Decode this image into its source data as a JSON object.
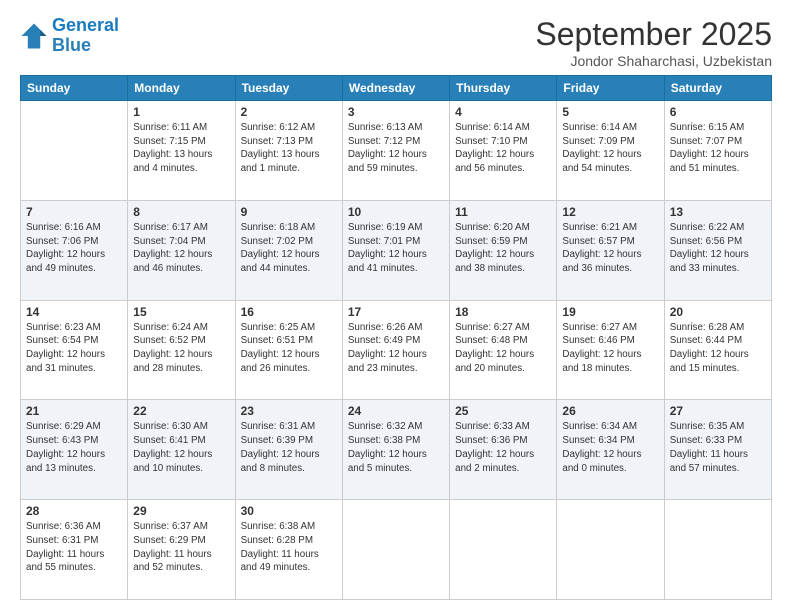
{
  "header": {
    "logo_line1": "General",
    "logo_line2": "Blue",
    "month": "September 2025",
    "location": "Jondor Shaharchasi, Uzbekistan"
  },
  "weekdays": [
    "Sunday",
    "Monday",
    "Tuesday",
    "Wednesday",
    "Thursday",
    "Friday",
    "Saturday"
  ],
  "weeks": [
    [
      {
        "day": "",
        "info": ""
      },
      {
        "day": "1",
        "info": "Sunrise: 6:11 AM\nSunset: 7:15 PM\nDaylight: 13 hours\nand 4 minutes."
      },
      {
        "day": "2",
        "info": "Sunrise: 6:12 AM\nSunset: 7:13 PM\nDaylight: 13 hours\nand 1 minute."
      },
      {
        "day": "3",
        "info": "Sunrise: 6:13 AM\nSunset: 7:12 PM\nDaylight: 12 hours\nand 59 minutes."
      },
      {
        "day": "4",
        "info": "Sunrise: 6:14 AM\nSunset: 7:10 PM\nDaylight: 12 hours\nand 56 minutes."
      },
      {
        "day": "5",
        "info": "Sunrise: 6:14 AM\nSunset: 7:09 PM\nDaylight: 12 hours\nand 54 minutes."
      },
      {
        "day": "6",
        "info": "Sunrise: 6:15 AM\nSunset: 7:07 PM\nDaylight: 12 hours\nand 51 minutes."
      }
    ],
    [
      {
        "day": "7",
        "info": "Sunrise: 6:16 AM\nSunset: 7:06 PM\nDaylight: 12 hours\nand 49 minutes."
      },
      {
        "day": "8",
        "info": "Sunrise: 6:17 AM\nSunset: 7:04 PM\nDaylight: 12 hours\nand 46 minutes."
      },
      {
        "day": "9",
        "info": "Sunrise: 6:18 AM\nSunset: 7:02 PM\nDaylight: 12 hours\nand 44 minutes."
      },
      {
        "day": "10",
        "info": "Sunrise: 6:19 AM\nSunset: 7:01 PM\nDaylight: 12 hours\nand 41 minutes."
      },
      {
        "day": "11",
        "info": "Sunrise: 6:20 AM\nSunset: 6:59 PM\nDaylight: 12 hours\nand 38 minutes."
      },
      {
        "day": "12",
        "info": "Sunrise: 6:21 AM\nSunset: 6:57 PM\nDaylight: 12 hours\nand 36 minutes."
      },
      {
        "day": "13",
        "info": "Sunrise: 6:22 AM\nSunset: 6:56 PM\nDaylight: 12 hours\nand 33 minutes."
      }
    ],
    [
      {
        "day": "14",
        "info": "Sunrise: 6:23 AM\nSunset: 6:54 PM\nDaylight: 12 hours\nand 31 minutes."
      },
      {
        "day": "15",
        "info": "Sunrise: 6:24 AM\nSunset: 6:52 PM\nDaylight: 12 hours\nand 28 minutes."
      },
      {
        "day": "16",
        "info": "Sunrise: 6:25 AM\nSunset: 6:51 PM\nDaylight: 12 hours\nand 26 minutes."
      },
      {
        "day": "17",
        "info": "Sunrise: 6:26 AM\nSunset: 6:49 PM\nDaylight: 12 hours\nand 23 minutes."
      },
      {
        "day": "18",
        "info": "Sunrise: 6:27 AM\nSunset: 6:48 PM\nDaylight: 12 hours\nand 20 minutes."
      },
      {
        "day": "19",
        "info": "Sunrise: 6:27 AM\nSunset: 6:46 PM\nDaylight: 12 hours\nand 18 minutes."
      },
      {
        "day": "20",
        "info": "Sunrise: 6:28 AM\nSunset: 6:44 PM\nDaylight: 12 hours\nand 15 minutes."
      }
    ],
    [
      {
        "day": "21",
        "info": "Sunrise: 6:29 AM\nSunset: 6:43 PM\nDaylight: 12 hours\nand 13 minutes."
      },
      {
        "day": "22",
        "info": "Sunrise: 6:30 AM\nSunset: 6:41 PM\nDaylight: 12 hours\nand 10 minutes."
      },
      {
        "day": "23",
        "info": "Sunrise: 6:31 AM\nSunset: 6:39 PM\nDaylight: 12 hours\nand 8 minutes."
      },
      {
        "day": "24",
        "info": "Sunrise: 6:32 AM\nSunset: 6:38 PM\nDaylight: 12 hours\nand 5 minutes."
      },
      {
        "day": "25",
        "info": "Sunrise: 6:33 AM\nSunset: 6:36 PM\nDaylight: 12 hours\nand 2 minutes."
      },
      {
        "day": "26",
        "info": "Sunrise: 6:34 AM\nSunset: 6:34 PM\nDaylight: 12 hours\nand 0 minutes."
      },
      {
        "day": "27",
        "info": "Sunrise: 6:35 AM\nSunset: 6:33 PM\nDaylight: 11 hours\nand 57 minutes."
      }
    ],
    [
      {
        "day": "28",
        "info": "Sunrise: 6:36 AM\nSunset: 6:31 PM\nDaylight: 11 hours\nand 55 minutes."
      },
      {
        "day": "29",
        "info": "Sunrise: 6:37 AM\nSunset: 6:29 PM\nDaylight: 11 hours\nand 52 minutes."
      },
      {
        "day": "30",
        "info": "Sunrise: 6:38 AM\nSunset: 6:28 PM\nDaylight: 11 hours\nand 49 minutes."
      },
      {
        "day": "",
        "info": ""
      },
      {
        "day": "",
        "info": ""
      },
      {
        "day": "",
        "info": ""
      },
      {
        "day": "",
        "info": ""
      }
    ]
  ]
}
